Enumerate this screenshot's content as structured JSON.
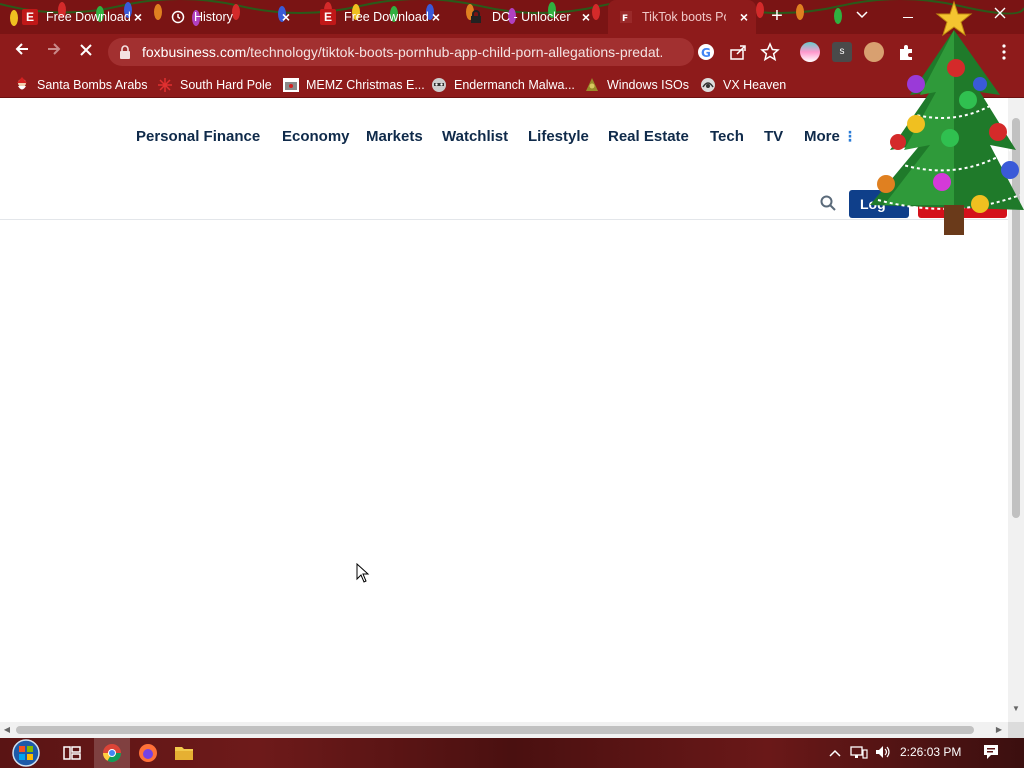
{
  "browser": {
    "tabs": [
      {
        "title": "Free Download",
        "icon": "e-letter-icon",
        "active": false
      },
      {
        "title": "History",
        "icon": "history-icon",
        "active": false
      },
      {
        "title": "Free Download",
        "icon": "e-letter-icon",
        "active": false
      },
      {
        "title": "DC - Unlocker",
        "icon": "dc-unlocker-icon",
        "active": false
      },
      {
        "title": "TikTok boots Po",
        "icon": "fox-business-icon",
        "active": true
      }
    ],
    "new_tab": "+",
    "tab_close": "×",
    "url": {
      "host": "foxbusiness.com",
      "path": "/technology/tiktok-boots-pornhub-app-child-porn-allegations-predat..."
    },
    "bookmarks": [
      {
        "label": "Santa Bombs Arabs",
        "icon": "santa-icon"
      },
      {
        "label": "South Hard Pole",
        "icon": "snowflake-icon"
      },
      {
        "label": "MEMZ Christmas E...",
        "icon": "memz-icon"
      },
      {
        "label": "Endermanch Malwa...",
        "icon": "raccoon-icon"
      },
      {
        "label": "Windows ISOs",
        "icon": "windows-iso-icon"
      },
      {
        "label": "VX Heaven",
        "icon": "vx-heaven-icon"
      }
    ]
  },
  "site": {
    "nav": [
      "Personal Finance",
      "Economy",
      "Markets",
      "Watchlist",
      "Lifestyle",
      "Real Estate",
      "Tech",
      "TV",
      "More"
    ],
    "more_dots": "⋮",
    "login_label": "Log",
    "colors": {
      "navy": "#0f2a4a",
      "login_blue": "#0f3f8a",
      "signup_red": "#d4111b"
    }
  },
  "taskbar": {
    "clock": "2:26:03 PM"
  },
  "theme": {
    "chrome_red": "#8e1b1b",
    "tabstrip_red": "#7a1414"
  }
}
